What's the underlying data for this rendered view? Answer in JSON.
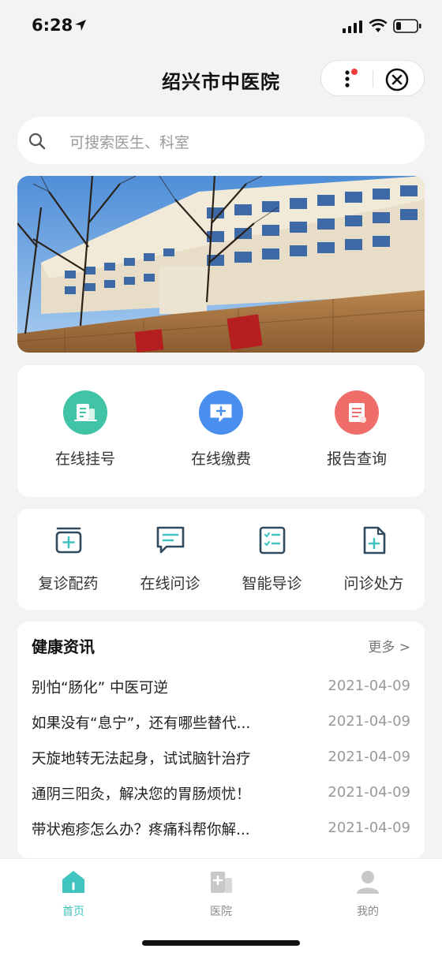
{
  "status_bar": {
    "time": "6:28"
  },
  "nav": {
    "title": "绍兴市中医院"
  },
  "search": {
    "placeholder": "可搜索医生、科室"
  },
  "main_services": [
    {
      "label": "在线挂号",
      "icon": "register-icon",
      "color": "#41c3a6"
    },
    {
      "label": "在线缴费",
      "icon": "payment-icon",
      "color": "#4a8ff0"
    },
    {
      "label": "报告查询",
      "icon": "report-icon",
      "color": "#ef6e6a"
    }
  ],
  "sub_services": [
    {
      "label": "复诊配药",
      "icon": "medicine-box-icon"
    },
    {
      "label": "在线问诊",
      "icon": "chat-icon"
    },
    {
      "label": "智能导诊",
      "icon": "checklist-icon"
    },
    {
      "label": "问诊处方",
      "icon": "prescription-icon"
    }
  ],
  "news": {
    "title": "健康资讯",
    "more": "更多 >",
    "items": [
      {
        "title": "别怕“肠化” 中医可逆",
        "date": "2021-04-09"
      },
      {
        "title": "如果没有“息宁”，还有哪些替代...",
        "date": "2021-04-09"
      },
      {
        "title": "天旋地转无法起身，试试脑针治疗",
        "date": "2021-04-09"
      },
      {
        "title": "通阴三阳灸，解决您的胃肠烦忧！",
        "date": "2021-04-09"
      },
      {
        "title": "带状疱疹怎么办？疼痛科帮你解...",
        "date": "2021-04-09"
      }
    ]
  },
  "tabbar": {
    "items": [
      {
        "label": "首页",
        "icon": "home-icon",
        "active": true
      },
      {
        "label": "医院",
        "icon": "hospital-icon",
        "active": false
      },
      {
        "label": "我的",
        "icon": "user-icon",
        "active": false
      }
    ]
  },
  "colors": {
    "accent": "#41c3bf",
    "icon_dark": "#2f4a5f",
    "icon_teal": "#41c3bf",
    "inactive": "#c8c8c8"
  }
}
